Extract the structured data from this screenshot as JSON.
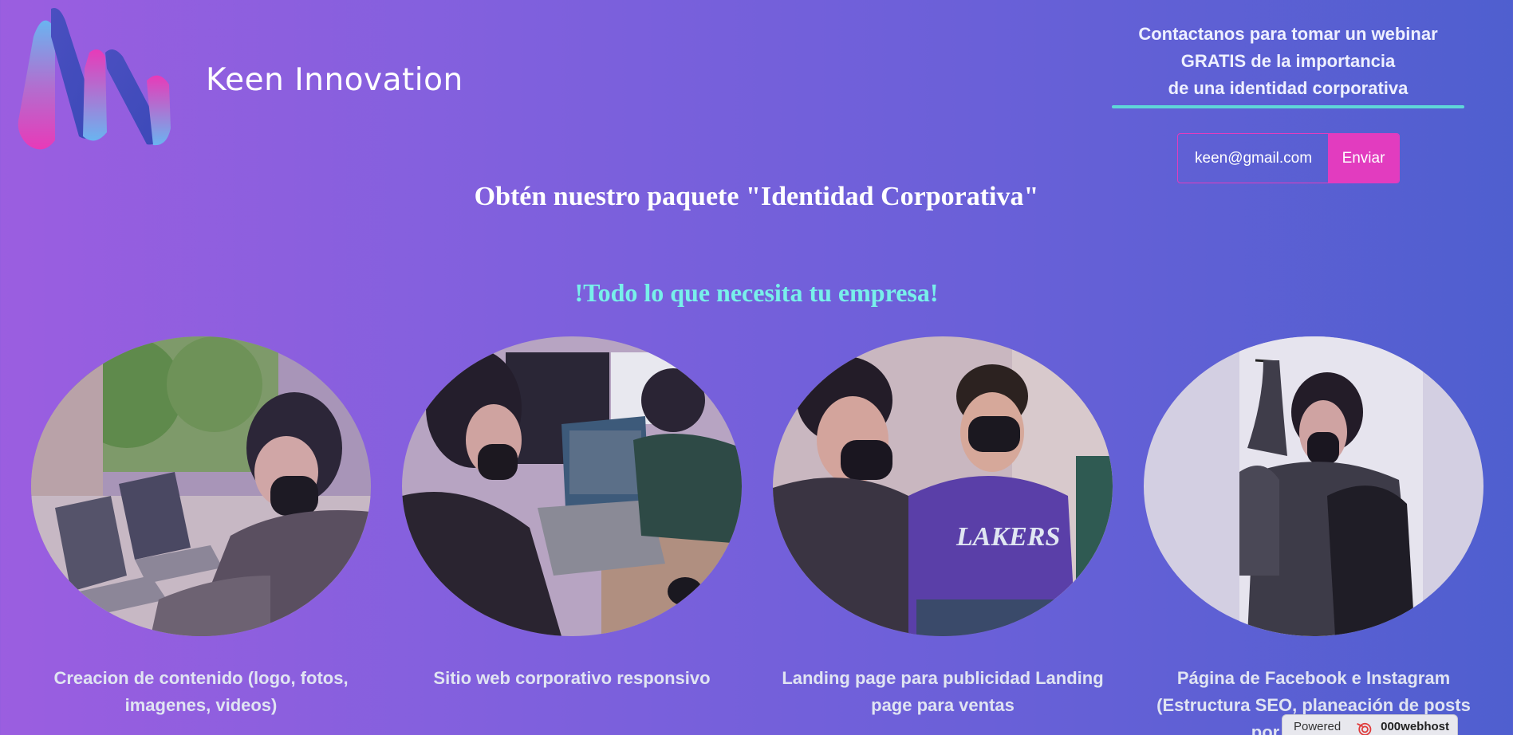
{
  "brand": {
    "name": "Keen Innovation",
    "logo": "keen-k-logo"
  },
  "contact": {
    "lines": [
      "Contactanos para tomar un webinar",
      "GRATIS de la importancia",
      "de una identidad corporativa"
    ],
    "email_value": "keen@gmail.com",
    "submit_label": "Enviar"
  },
  "headline": "Obtén nuestro paquete \"Identidad Corporativa\"",
  "subheadline": "!Todo lo que necesita tu empresa!",
  "cards": [
    {
      "caption": "Creacion de contenido (logo, fotos, imagenes, videos)",
      "photo": "two-people-with-laptops-by-window"
    },
    {
      "caption": "Sitio web corporativo responsivo",
      "photo": "person-at-computer-desk"
    },
    {
      "caption": "Landing page para publicidad Landing page para ventas",
      "photo": "two-people-talking-lakers-hoodie"
    },
    {
      "caption": "Página de Facebook e Instagram (Estructura SEO, planeación de posts por un mes, co",
      "photo": "person-writing-on-whiteboard"
    }
  ],
  "badge": {
    "prefix": "Powered by",
    "brand": "000webhost"
  },
  "colors": {
    "accent": "#e23cbf",
    "teal": "#5fd6d8",
    "subhead": "#78f0ea"
  }
}
